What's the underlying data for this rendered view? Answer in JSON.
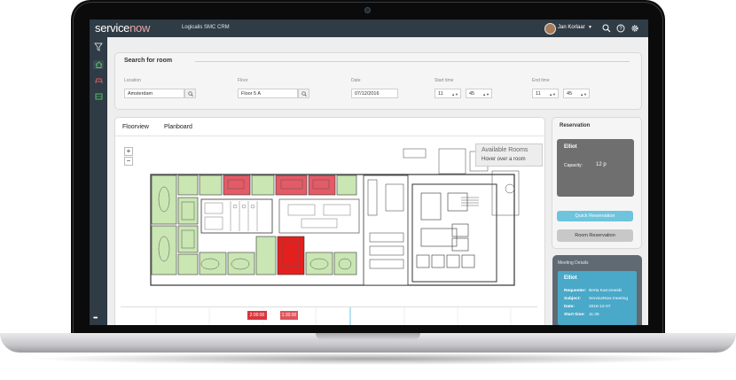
{
  "header": {
    "logo_part1": "service",
    "logo_part2": "now",
    "app_name": "Logicalis SMC CRM",
    "user_name": "Jan Korlaar",
    "icons": [
      "search-icon",
      "help-icon",
      "gear-icon"
    ]
  },
  "sidebar": {
    "items": [
      "filter-icon",
      "home-icon",
      "car-icon",
      "room-icon"
    ],
    "more": "•••"
  },
  "search": {
    "title": "Search for room",
    "location": {
      "label": "Location",
      "value": "Amsterdam"
    },
    "floor": {
      "label": "Floor",
      "value": "Floor 5 A"
    },
    "date": {
      "label": "Date",
      "value": "07/12/2016"
    },
    "start_time": {
      "label": "Start time",
      "hour": "11",
      "minute": "45"
    },
    "end_time": {
      "label": "End time",
      "hour": "11",
      "minute": "45"
    }
  },
  "floorview": {
    "tabs": [
      "Floorview",
      "Planboard"
    ],
    "zoom_in": "+",
    "zoom_out": "−",
    "tooltip_title": "Available Rooms",
    "tooltip_sub": "Hover over a room",
    "timeline_slots": [
      "2:00:00",
      "1:30:00"
    ]
  },
  "reservation": {
    "title": "Reservation",
    "card_name": "Elliot",
    "capacity_label": "Capacity:",
    "capacity_value": "12 p",
    "quick_button": "Quick Reservation",
    "room_button": "Room Reservation"
  },
  "meeting": {
    "title": "Meeting Details",
    "name": "Elliot",
    "requester_label": "Requester:",
    "requester": "Berta Karczewski",
    "subject_label": "Subject:",
    "subject": "ServiceNow meeting",
    "date_label": "Date:",
    "date": "2016-12-07",
    "start_label": "Start time:",
    "start": "11:45"
  },
  "colors": {
    "header_bg": "#2f3b45",
    "room_available": "#c9e6b3",
    "room_booked": "#e35b67",
    "room_selected": "#e3201e",
    "accent_button": "#6ec3dd",
    "meeting_card": "#4aa8c8"
  }
}
